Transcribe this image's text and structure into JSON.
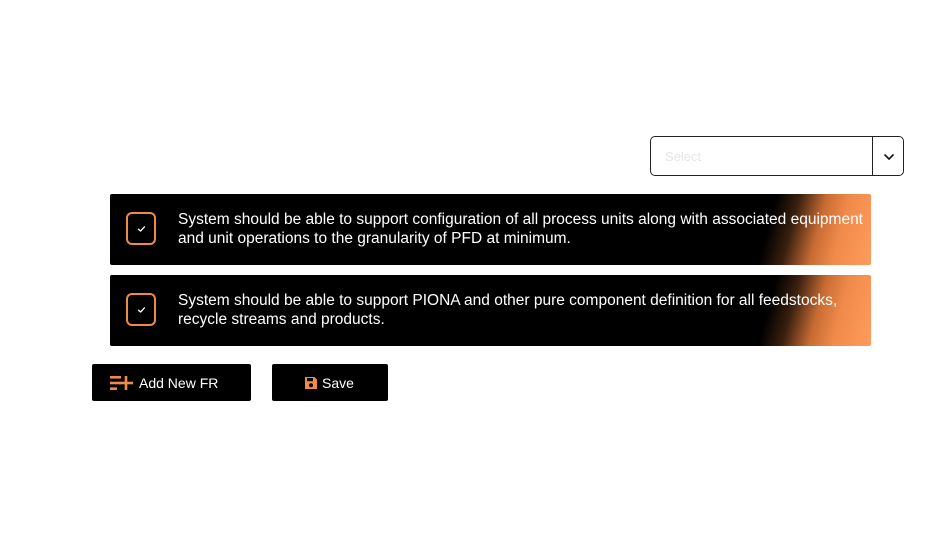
{
  "select": {
    "placeholder": "Select",
    "value": ""
  },
  "requirements": [
    {
      "checked": true,
      "text": "System should be able to support configuration of all process units along with associated equipment and unit operations to the granularity of PFD at minimum."
    },
    {
      "checked": true,
      "text": "System should be able to support PIONA and other pure component definition for all feedstocks, recycle streams and products."
    }
  ],
  "actions": {
    "add_label": "Add New FR",
    "save_label": "Save"
  },
  "colors": {
    "accent": "#f08a4b",
    "card_bg": "#000000",
    "button_bg": "#000000"
  },
  "icons": {
    "dropdown": "chevron-down-icon",
    "add": "add-list-icon",
    "save": "floppy-disk-icon",
    "check": "check-icon"
  }
}
